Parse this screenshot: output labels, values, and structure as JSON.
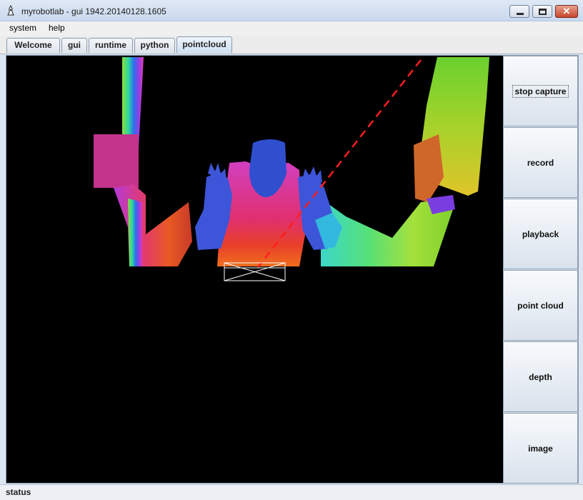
{
  "window": {
    "title": "myrobotlab - gui 1942.20140128.1605",
    "icon": "robot-app-icon",
    "controls": {
      "close_glyph": "✕"
    }
  },
  "menu": {
    "items": [
      "system",
      "help"
    ]
  },
  "tabs": [
    {
      "label": "Welcome",
      "active": false
    },
    {
      "label": "gui",
      "active": false
    },
    {
      "label": "runtime",
      "active": false
    },
    {
      "label": "python",
      "active": false
    },
    {
      "label": "pointcloud",
      "active": true
    }
  ],
  "sidebar": {
    "buttons": [
      {
        "label": "stop capture",
        "focused": true
      },
      {
        "label": "record",
        "focused": false
      },
      {
        "label": "playback",
        "focused": false
      },
      {
        "label": "point cloud",
        "focused": false
      },
      {
        "label": "depth",
        "focused": false
      },
      {
        "label": "image",
        "focused": false
      }
    ]
  },
  "pointcloud_view": {
    "background_color": "#000000",
    "content": "depth colormap point cloud with red dashed ray and white bounding box"
  },
  "status": {
    "text": "status"
  }
}
